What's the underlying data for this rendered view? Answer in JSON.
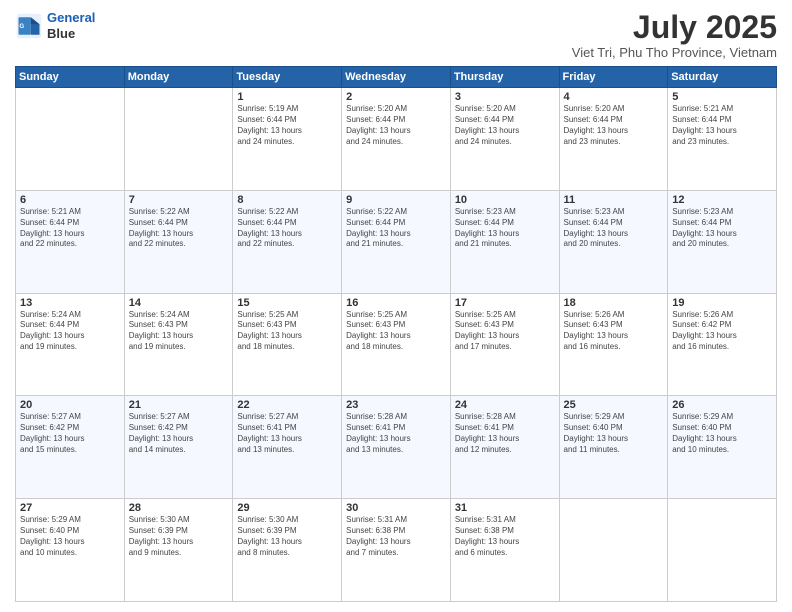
{
  "header": {
    "logo_line1": "General",
    "logo_line2": "Blue",
    "title": "July 2025",
    "subtitle": "Viet Tri, Phu Tho Province, Vietnam"
  },
  "weekdays": [
    "Sunday",
    "Monday",
    "Tuesday",
    "Wednesday",
    "Thursday",
    "Friday",
    "Saturday"
  ],
  "weeks": [
    [
      {
        "day": "",
        "info": ""
      },
      {
        "day": "",
        "info": ""
      },
      {
        "day": "1",
        "info": "Sunrise: 5:19 AM\nSunset: 6:44 PM\nDaylight: 13 hours\nand 24 minutes."
      },
      {
        "day": "2",
        "info": "Sunrise: 5:20 AM\nSunset: 6:44 PM\nDaylight: 13 hours\nand 24 minutes."
      },
      {
        "day": "3",
        "info": "Sunrise: 5:20 AM\nSunset: 6:44 PM\nDaylight: 13 hours\nand 24 minutes."
      },
      {
        "day": "4",
        "info": "Sunrise: 5:20 AM\nSunset: 6:44 PM\nDaylight: 13 hours\nand 23 minutes."
      },
      {
        "day": "5",
        "info": "Sunrise: 5:21 AM\nSunset: 6:44 PM\nDaylight: 13 hours\nand 23 minutes."
      }
    ],
    [
      {
        "day": "6",
        "info": "Sunrise: 5:21 AM\nSunset: 6:44 PM\nDaylight: 13 hours\nand 22 minutes."
      },
      {
        "day": "7",
        "info": "Sunrise: 5:22 AM\nSunset: 6:44 PM\nDaylight: 13 hours\nand 22 minutes."
      },
      {
        "day": "8",
        "info": "Sunrise: 5:22 AM\nSunset: 6:44 PM\nDaylight: 13 hours\nand 22 minutes."
      },
      {
        "day": "9",
        "info": "Sunrise: 5:22 AM\nSunset: 6:44 PM\nDaylight: 13 hours\nand 21 minutes."
      },
      {
        "day": "10",
        "info": "Sunrise: 5:23 AM\nSunset: 6:44 PM\nDaylight: 13 hours\nand 21 minutes."
      },
      {
        "day": "11",
        "info": "Sunrise: 5:23 AM\nSunset: 6:44 PM\nDaylight: 13 hours\nand 20 minutes."
      },
      {
        "day": "12",
        "info": "Sunrise: 5:23 AM\nSunset: 6:44 PM\nDaylight: 13 hours\nand 20 minutes."
      }
    ],
    [
      {
        "day": "13",
        "info": "Sunrise: 5:24 AM\nSunset: 6:44 PM\nDaylight: 13 hours\nand 19 minutes."
      },
      {
        "day": "14",
        "info": "Sunrise: 5:24 AM\nSunset: 6:43 PM\nDaylight: 13 hours\nand 19 minutes."
      },
      {
        "day": "15",
        "info": "Sunrise: 5:25 AM\nSunset: 6:43 PM\nDaylight: 13 hours\nand 18 minutes."
      },
      {
        "day": "16",
        "info": "Sunrise: 5:25 AM\nSunset: 6:43 PM\nDaylight: 13 hours\nand 18 minutes."
      },
      {
        "day": "17",
        "info": "Sunrise: 5:25 AM\nSunset: 6:43 PM\nDaylight: 13 hours\nand 17 minutes."
      },
      {
        "day": "18",
        "info": "Sunrise: 5:26 AM\nSunset: 6:43 PM\nDaylight: 13 hours\nand 16 minutes."
      },
      {
        "day": "19",
        "info": "Sunrise: 5:26 AM\nSunset: 6:42 PM\nDaylight: 13 hours\nand 16 minutes."
      }
    ],
    [
      {
        "day": "20",
        "info": "Sunrise: 5:27 AM\nSunset: 6:42 PM\nDaylight: 13 hours\nand 15 minutes."
      },
      {
        "day": "21",
        "info": "Sunrise: 5:27 AM\nSunset: 6:42 PM\nDaylight: 13 hours\nand 14 minutes."
      },
      {
        "day": "22",
        "info": "Sunrise: 5:27 AM\nSunset: 6:41 PM\nDaylight: 13 hours\nand 13 minutes."
      },
      {
        "day": "23",
        "info": "Sunrise: 5:28 AM\nSunset: 6:41 PM\nDaylight: 13 hours\nand 13 minutes."
      },
      {
        "day": "24",
        "info": "Sunrise: 5:28 AM\nSunset: 6:41 PM\nDaylight: 13 hours\nand 12 minutes."
      },
      {
        "day": "25",
        "info": "Sunrise: 5:29 AM\nSunset: 6:40 PM\nDaylight: 13 hours\nand 11 minutes."
      },
      {
        "day": "26",
        "info": "Sunrise: 5:29 AM\nSunset: 6:40 PM\nDaylight: 13 hours\nand 10 minutes."
      }
    ],
    [
      {
        "day": "27",
        "info": "Sunrise: 5:29 AM\nSunset: 6:40 PM\nDaylight: 13 hours\nand 10 minutes."
      },
      {
        "day": "28",
        "info": "Sunrise: 5:30 AM\nSunset: 6:39 PM\nDaylight: 13 hours\nand 9 minutes."
      },
      {
        "day": "29",
        "info": "Sunrise: 5:30 AM\nSunset: 6:39 PM\nDaylight: 13 hours\nand 8 minutes."
      },
      {
        "day": "30",
        "info": "Sunrise: 5:31 AM\nSunset: 6:38 PM\nDaylight: 13 hours\nand 7 minutes."
      },
      {
        "day": "31",
        "info": "Sunrise: 5:31 AM\nSunset: 6:38 PM\nDaylight: 13 hours\nand 6 minutes."
      },
      {
        "day": "",
        "info": ""
      },
      {
        "day": "",
        "info": ""
      }
    ]
  ]
}
